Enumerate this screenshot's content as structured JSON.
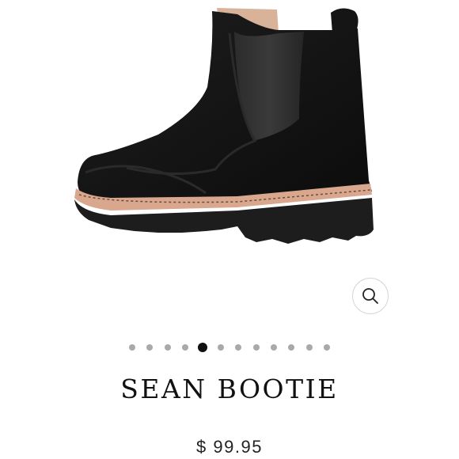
{
  "product": {
    "name": "SEAN BOOTIE",
    "price": "$ 99.95",
    "image_alt_icon": "boot-product-image"
  },
  "gallery": {
    "total_slides": 12,
    "active_index": 4
  },
  "zoom": {
    "icon": "magnifier-icon"
  },
  "colors": {
    "boot": "#141414",
    "welt": "#d9a78d",
    "sole": "#1d1d1d",
    "active_dot": "#111111",
    "inactive_dot": "#a9a9a9"
  }
}
